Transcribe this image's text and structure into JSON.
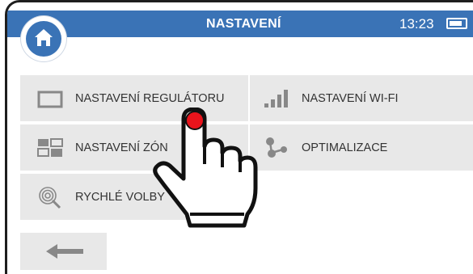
{
  "header": {
    "title": "NASTAVENÍ",
    "time": "13:23",
    "battery_level": 0.85,
    "accent_color": "#3a73b6"
  },
  "home_button": {
    "icon": "home-icon"
  },
  "menu": {
    "items": [
      {
        "label": "NASTAVENÍ REGULÁTORU",
        "icon": "monitor-icon"
      },
      {
        "label": "NASTAVENÍ ZÓN",
        "icon": "zones-icon"
      },
      {
        "label": "RYCHLÉ VOLBY",
        "icon": "fingerprint-icon"
      },
      {
        "label": "NASTAVENÍ WI-FI",
        "icon": "signal-bars-icon"
      },
      {
        "label": "OPTIMALIZACE",
        "icon": "molecule-icon"
      }
    ]
  },
  "back_button": {
    "icon": "back-arrow-icon"
  },
  "overlay": {
    "icon": "pointing-hand-icon",
    "touch_color": "#e8141c"
  }
}
